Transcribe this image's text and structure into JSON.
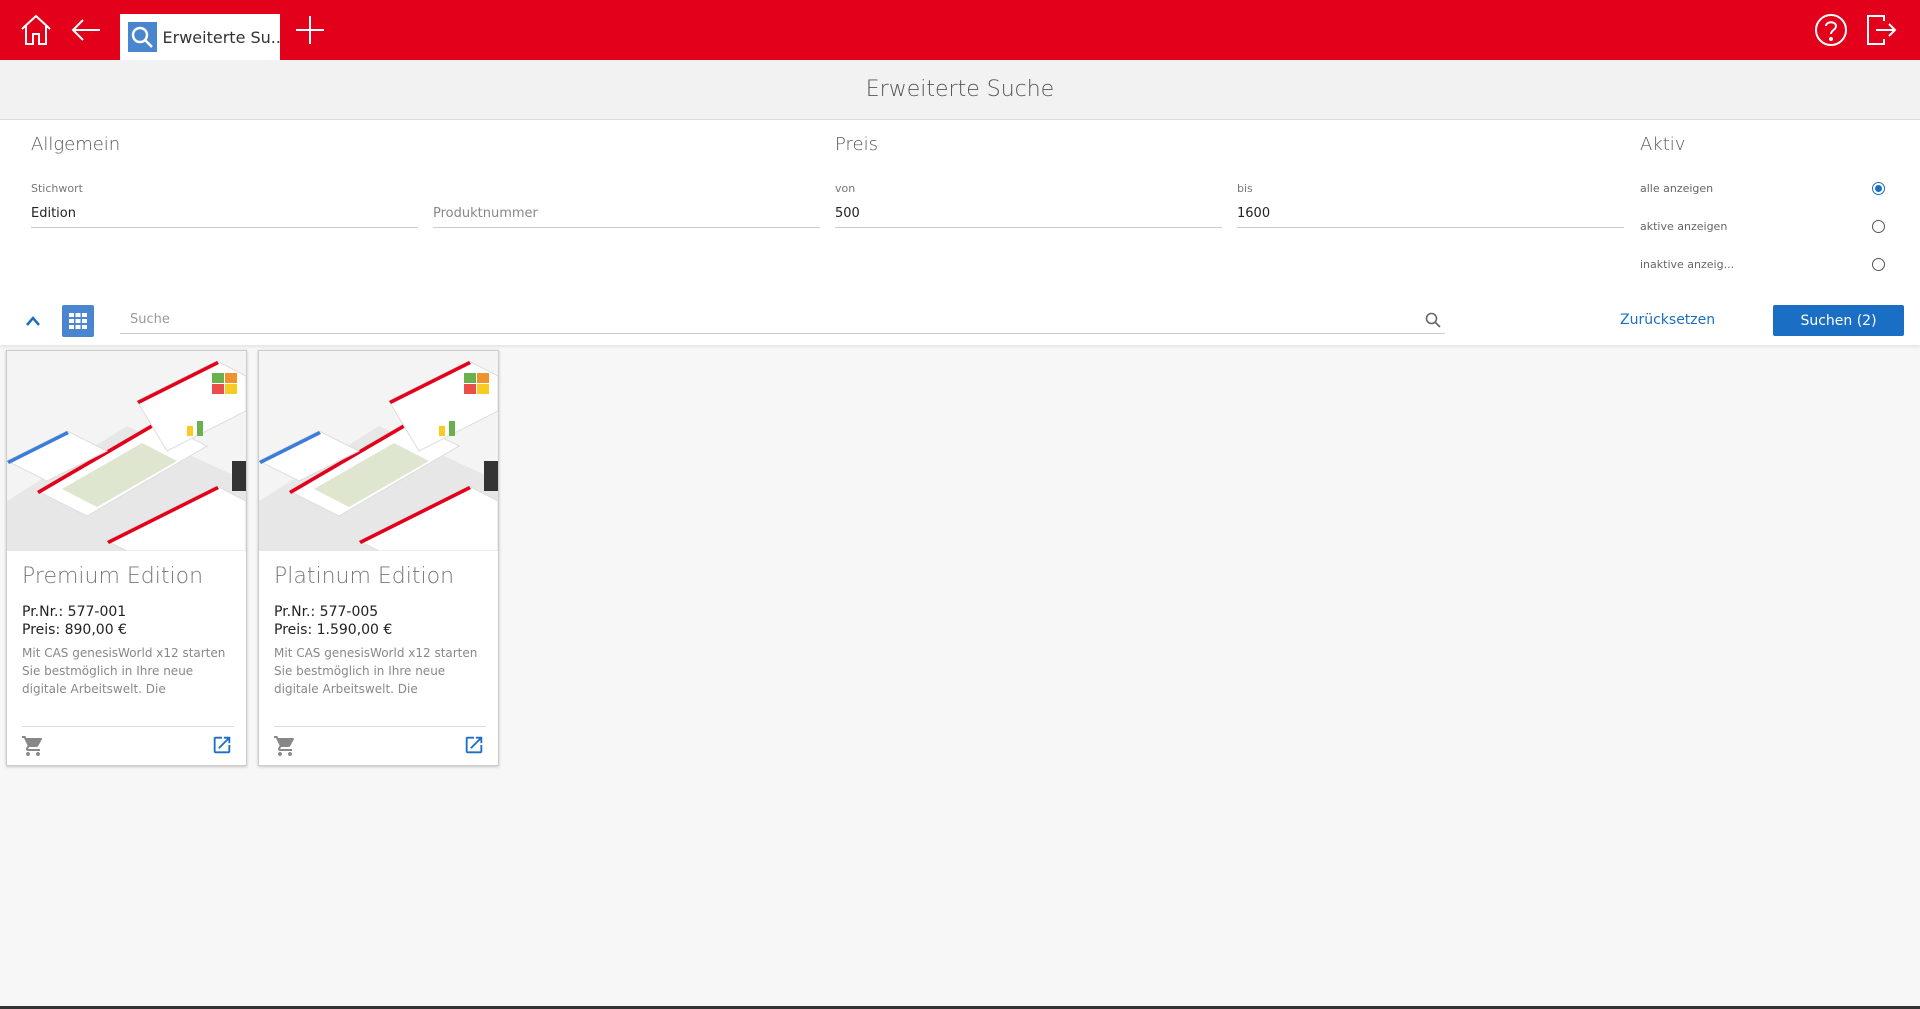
{
  "topbar": {
    "tab_label": "Erweiterte Su...",
    "icons": [
      "home-icon",
      "back-arrow-icon",
      "search-icon",
      "plus-icon",
      "help-icon",
      "logout-icon"
    ],
    "color": "#e2001a"
  },
  "page": {
    "title": "Erweiterte Suche"
  },
  "filters": {
    "general": {
      "title": "Allgemein",
      "keyword_label": "Stichwort",
      "keyword_value": "Edition",
      "product_number_placeholder": "Produktnummer"
    },
    "price": {
      "title": "Preis",
      "from_label": "von",
      "from_value": "500",
      "to_label": "bis",
      "to_value": "1600"
    },
    "active": {
      "title": "Aktiv",
      "options": [
        {
          "label": "alle anzeigen",
          "checked": true
        },
        {
          "label": "aktive anzeigen",
          "checked": false
        },
        {
          "label": "inaktive anzeig...",
          "checked": false
        }
      ]
    }
  },
  "toolbar": {
    "search_placeholder": "Suche",
    "reset_label": "Zurücksetzen",
    "search_button_label": "Suchen (2)",
    "accent": "#1a6fc4"
  },
  "cards": [
    {
      "title": "Premium Edition",
      "product_number": "Pr.Nr.: 577-001",
      "price": "Preis: 890,00 €",
      "description": "Mit CAS genesisWorld x12 starten Sie bestmöglich in Ihre neue digitale Arbeitswelt. Die"
    },
    {
      "title": "Platinum Edition",
      "product_number": "Pr.Nr.: 577-005",
      "price": "Preis: 1.590,00 €",
      "description": "Mit CAS genesisWorld x12 starten Sie bestmöglich in Ihre neue digitale Arbeitswelt. Die"
    }
  ]
}
